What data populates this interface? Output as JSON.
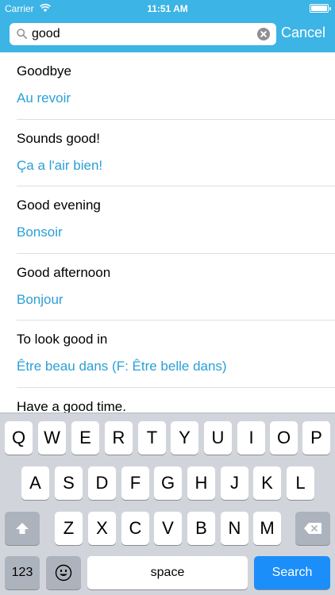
{
  "status": {
    "carrier": "Carrier",
    "time": "11:51 AM"
  },
  "search": {
    "value": "good"
  },
  "cancel_label": "Cancel",
  "results": [
    {
      "english": "Goodbye",
      "french": "Au revoir"
    },
    {
      "english": "Sounds good!",
      "french": "Ça a l'air bien!"
    },
    {
      "english": "Good evening",
      "french": "Bonsoir"
    },
    {
      "english": "Good afternoon",
      "french": "Bonjour"
    },
    {
      "english": "To look good in",
      "french": "Être beau dans (F: Être belle dans)"
    },
    {
      "english": "Have a good time.",
      "french": ""
    }
  ],
  "keyboard": {
    "row1": [
      "Q",
      "W",
      "E",
      "R",
      "T",
      "Y",
      "U",
      "I",
      "O",
      "P"
    ],
    "row2": [
      "A",
      "S",
      "D",
      "F",
      "G",
      "H",
      "J",
      "K",
      "L"
    ],
    "row3": [
      "Z",
      "X",
      "C",
      "V",
      "B",
      "N",
      "M"
    ],
    "numbers_label": "123",
    "space_label": "space",
    "search_label": "Search"
  },
  "colors": {
    "accent": "#3cb4e5",
    "translation": "#2a9fd6",
    "search_key": "#1c8ef9"
  }
}
